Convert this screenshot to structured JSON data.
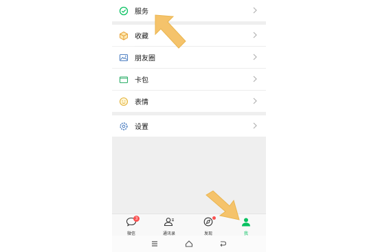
{
  "menu": {
    "services": "服务",
    "favorites": "收藏",
    "moments": "朋友圈",
    "cards": "卡包",
    "stickers": "表情",
    "settings": "设置"
  },
  "tabbar": {
    "chats": {
      "label": "微信",
      "badge": "3"
    },
    "contacts": {
      "label": "通讯录"
    },
    "discover": {
      "label": "发现"
    },
    "me": {
      "label": "我"
    }
  },
  "colors": {
    "accent_green": "#07c160",
    "badge_red": "#fa5151",
    "annotation_arrow": "#f5c36b"
  },
  "icons": [
    "services-icon",
    "favorites-icon",
    "moments-icon",
    "cards-icon",
    "stickers-icon",
    "settings-icon",
    "chevron-right-icon",
    "chat-icon",
    "contacts-icon",
    "discover-icon",
    "me-icon",
    "menu-icon",
    "home-icon",
    "back-icon"
  ]
}
